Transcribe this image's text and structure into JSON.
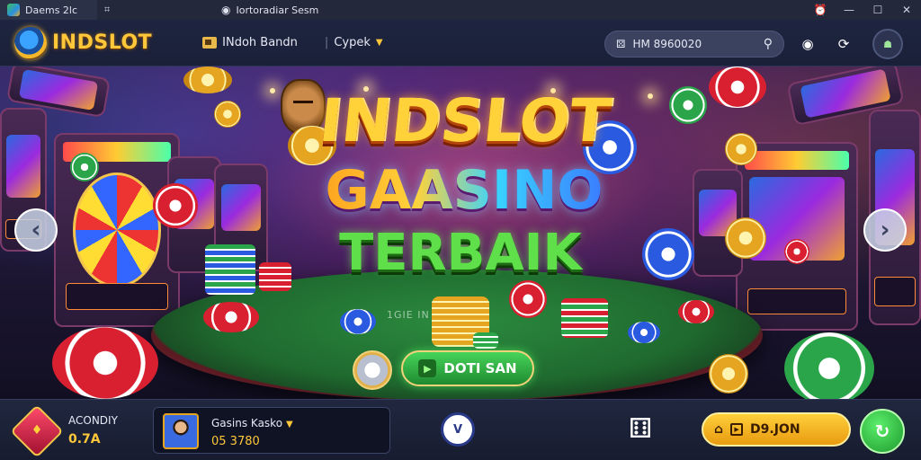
{
  "titlebar": {
    "tab1": "Daems 2lc",
    "tab3": "Iortoradiar Sesm",
    "icons": {
      "app": "app-icon",
      "grid": "grid-icon",
      "alarm": "alarm-icon",
      "minimize": "minimize-icon",
      "maximize": "maximize-icon",
      "close": "close-icon"
    }
  },
  "header": {
    "logo": "INDSLOT",
    "nav": [
      {
        "label": "INdoh Bandn",
        "icon": "news-icon"
      },
      {
        "label": "Cypek",
        "icon": "chevron-down-icon"
      }
    ],
    "search_value": "HM 8960020",
    "icons": {
      "search_left": "dice-icon",
      "search": "search-icon",
      "target": "target-icon",
      "sync": "sync-icon",
      "avatar": "avatar-icon"
    }
  },
  "hero": {
    "title_line1": "INDSLOT",
    "title_line2": "GAASINO",
    "title_line3": "TERBAIK",
    "felt_text": "1GIE IN",
    "cta_label": "DOTI SAN",
    "icons": {
      "prev": "chevron-left-icon",
      "next": "chevron-right-icon",
      "cta": "play-icon"
    }
  },
  "bottombar": {
    "balance_label": "ACONDIY",
    "balance_value": "0.7A",
    "card_name": "Gasins Kasko",
    "card_value": "05 3780",
    "mid_label": "V",
    "pill_label": "D9.JON",
    "icons": {
      "badge": "diamond-badge-icon",
      "dice": "dice-icon",
      "home": "home-icon",
      "card": "card-icon",
      "share": "share-icon"
    },
    "colors": {
      "accent": "#ffc83a",
      "cta": "#2aa54a"
    }
  }
}
